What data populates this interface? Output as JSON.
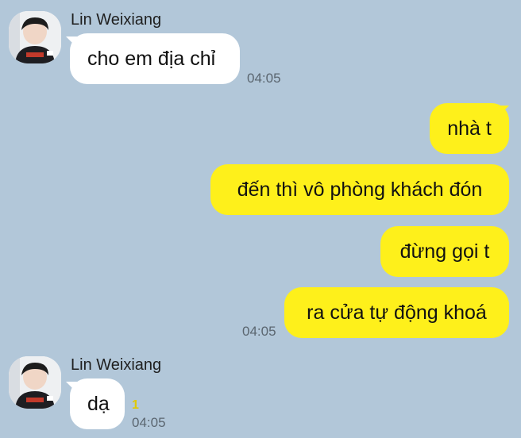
{
  "colors": {
    "background": "#b2c7d9",
    "incoming_bubble": "#ffffff",
    "outgoing_bubble": "#fef01b",
    "unread_badge": "#e0c800"
  },
  "conversation": {
    "group1": {
      "sender": "Lin Weixiang",
      "avatar": "profile-photo",
      "messages": [
        "cho em địa chỉ"
      ],
      "time": "04:05"
    },
    "outgoing": {
      "messages": [
        "nhà t",
        "đến thì vô phòng khách đón",
        "đừng gọi t",
        "ra cửa tự động khoá"
      ],
      "time": "04:05"
    },
    "group2": {
      "sender": "Lin Weixiang",
      "avatar": "profile-photo",
      "messages": [
        "dạ"
      ],
      "unread": "1",
      "time": "04:05"
    }
  }
}
